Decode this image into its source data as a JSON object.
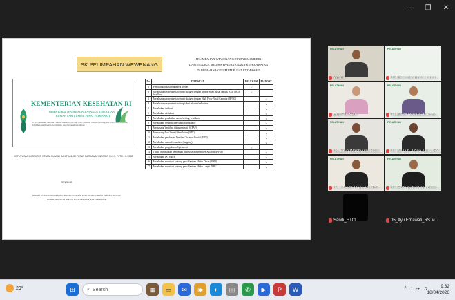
{
  "window": {
    "controls": [
      "—",
      "❐",
      "✕"
    ]
  },
  "slide": {
    "sk_title": "SK PELIMPAHAN WEWENANG",
    "doc": {
      "kemkes_title": "KEMENTERIAN KESEHATAN RI",
      "sub1": "DIREKTORAT JENDERAL PELAYANAN KESEHATAN",
      "sub2": "RUMAH SAKIT UMUM PUSAT FATMAWATI",
      "address": "Jl. RS Fatmawati, Cilandak - Jakarta Selatan 12430 Telp. (021) 7501524, 7660552 (Hunting) Fax. (021) 7690123 E-mail: info@fatmawatihospital.com Website: www.fatmawatihospital.com",
      "line1": "KEPUTUSAN DIREKTUR UTAMA RUMAH SAKIT UMUM PUSAT FATMAWATI NOMOR H.K.S. F/ TR / II /2022",
      "line2": "TENTANG",
      "line3": "PENDELEGASIAN WEWENANG TINDAKAN MEDIS DARI TENAGA MEDIS KEPADA TENAGA KEPERAWATAN DI RUMAH SAKIT UMUM PUSAT FATMAWATI"
    },
    "heading_lines": [
      "PELIMPAHAN WEWENANG TINDAKAN MEDIK",
      "DARI TENAGA MEDIS KEPADA TENAGA KEPERAWATAN",
      "DI RUMAH SAKIT UMUM PUSAT FATMAWATI"
    ],
    "table": {
      "headers": [
        "No.",
        "TINDAKAN",
        "DELEGASI",
        "MANDAT"
      ],
      "rows": [
        {
          "no": "1",
          "tindakan": "Pemasangan nasopharingeal airway",
          "delegasi": "√",
          "mandat": ""
        },
        {
          "no": "2",
          "tindakan": "Melaksanakan pemberian terapi oksigen dengan simple mask, nasal canula, RM, NRM, head box",
          "delegasi": "√",
          "mandat": ""
        },
        {
          "no": "3",
          "tindakan": "Melaksanakan pemberian terapi oksigen dengan High Flow Nasal Cannula (HFNC)",
          "delegasi": "",
          "mandat": "√"
        },
        {
          "no": "4",
          "tindakan": "Melaksanakan pemberian terapi obat inhalasi/nebuliser",
          "delegasi": "",
          "mandat": "√"
        },
        {
          "no": "5",
          "tindakan": "Melakukan intubasi",
          "delegasi": "",
          "mandat": "√"
        },
        {
          "no": "6",
          "tindakan": "Melakukan ekstubasi",
          "delegasi": "",
          "mandat": "√"
        },
        {
          "no": "7",
          "tindakan": "Melakukan perubahan modul/setting ventilator",
          "delegasi": "",
          "mandat": "√"
        },
        {
          "no": "8",
          "tindakan": "Melakukan weaning/penyapihan ventilator",
          "delegasi": "",
          "mandat": "√"
        },
        {
          "no": "9",
          "tindakan": "Memasang Ventilasi tekanan positif (CPAP)",
          "delegasi": "",
          "mandat": "√"
        },
        {
          "no": "10",
          "tindakan": "Memasang Non Invasif Ventilation (NIV)",
          "delegasi": "",
          "mandat": "√"
        },
        {
          "no": "11",
          "tindakan": "Melakukan pemberian Ventilasi Tekanan Positif (VTP)",
          "delegasi": "",
          "mandat": "√"
        },
        {
          "no": "12",
          "tindakan": "Melakukan manual resusitasi (bagging)",
          "delegasi": "",
          "mandat": "√"
        },
        {
          "no": "13",
          "tindakan": "Melakukan pengukuran Spirometri",
          "delegasi": "√",
          "mandat": ""
        },
        {
          "no": "14",
          "tindakan": "Titrasi (melakukan pemberian obat secara intermitten &/lanjut device)",
          "delegasi": "",
          "mandat": "√"
        },
        {
          "no": "15",
          "tindakan": "Melakukan DC Shock",
          "delegasi": "",
          "mandat": "√"
        },
        {
          "no": "16",
          "tindakan": "Melakukan resusitasi jantung paru/Bantuan Hidup Dasar (BHD)",
          "delegasi": "",
          "mandat": "√"
        },
        {
          "no": "17",
          "tindakan": "Melakukan resusitasi jantung paru/Bantuan Hidup Lanjut (BHL)",
          "delegasi": "",
          "mandat": "√"
        }
      ]
    }
  },
  "participants": [
    {
      "name": "Wisda",
      "kind": "person",
      "skin": "#8a5a3c",
      "top": "#3a3a3a",
      "bg": "#d9d4c8"
    },
    {
      "name": "05_Bea masruroh_rsum...",
      "kind": "slide",
      "bg": "#eef3ee"
    },
    {
      "name": "Eny Purwani",
      "kind": "person",
      "skin": "#c89a7a",
      "top": "#d9a0c0",
      "bg": "#eceae2"
    },
    {
      "name": "04_Dewi Novitasari_RS...",
      "kind": "person",
      "skin": "#b07a56",
      "top": "#6a5a8a",
      "bg": "#e8efe6"
    },
    {
      "name": "04_Erlin Wachyuni_Rsm...",
      "kind": "person",
      "skin": "#7a4e36",
      "top": "#3a3a3a",
      "bg": "#e6e4de"
    },
    {
      "name": "07_Ni Luh J Aria Nurs_RS...",
      "kind": "person",
      "skin": "#6a4430",
      "top": "#2a2a2a",
      "bg": "#e8ece6"
    },
    {
      "name": "07_I Gede Hary Adi_RS...",
      "kind": "person",
      "skin": "#8a5a3c",
      "top": "#222222",
      "bg": "#ece8e0"
    },
    {
      "name": "07_Putu putu Wara dewi...",
      "kind": "person",
      "skin": "#9a6a48",
      "top": "#1e1e1e",
      "bg": "#e4ece2"
    },
    {
      "name": "Sandi_HTCI",
      "kind": "camera-off"
    },
    {
      "name": "05_Ayu Ernawati_RS M...",
      "kind": "empty"
    }
  ],
  "tile_logo_text": "PELATIHAN",
  "taskbar": {
    "temperature": "29°",
    "search_placeholder": "Search",
    "tray": [
      "^",
      "◔",
      "✈",
      "♫"
    ],
    "time": "9:32",
    "date": "18/04/2026"
  }
}
